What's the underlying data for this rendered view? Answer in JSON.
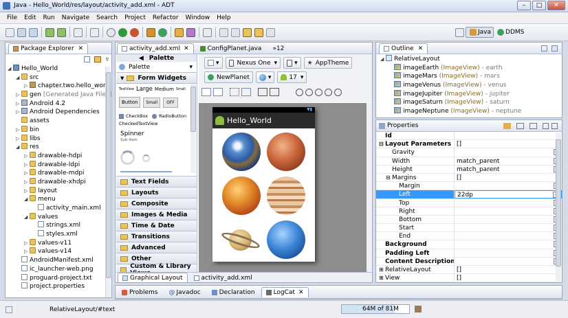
{
  "window": {
    "title": "Java - Hello_World/res/layout/activity_add.xml - ADT"
  },
  "menu": [
    "File",
    "Edit",
    "Run",
    "Navigate",
    "Search",
    "Project",
    "Refactor",
    "Window",
    "Help"
  ],
  "perspectives": {
    "java": "Java",
    "ddms": "DDMS"
  },
  "package_explorer": {
    "title": "Package Explorer",
    "items": [
      {
        "label": "Hello_World",
        "depth": 0,
        "exp": "◢",
        "icon": "proj"
      },
      {
        "label": "src",
        "depth": 1,
        "exp": "◢",
        "icon": "fold"
      },
      {
        "label": "chapter.two.hello_world",
        "depth": 2,
        "exp": "▷",
        "icon": "pkg"
      },
      {
        "label": "gen",
        "extra": " [Generated Java Files]",
        "depth": 1,
        "exp": "▷",
        "icon": "fold"
      },
      {
        "label": "Android 4.2",
        "depth": 1,
        "exp": "▷",
        "icon": "lib"
      },
      {
        "label": "Android Dependencies",
        "depth": 1,
        "exp": "▷",
        "icon": "lib"
      },
      {
        "label": "assets",
        "depth": 1,
        "exp": "",
        "icon": "fold"
      },
      {
        "label": "bin",
        "depth": 1,
        "exp": "▷",
        "icon": "fold"
      },
      {
        "label": "libs",
        "depth": 1,
        "exp": "▷",
        "icon": "fold"
      },
      {
        "label": "res",
        "depth": 1,
        "exp": "◢",
        "icon": "fold"
      },
      {
        "label": "drawable-hdpi",
        "depth": 2,
        "exp": "▷",
        "icon": "fold"
      },
      {
        "label": "drawable-ldpi",
        "depth": 2,
        "exp": "▷",
        "icon": "fold"
      },
      {
        "label": "drawable-mdpi",
        "depth": 2,
        "exp": "▷",
        "icon": "fold"
      },
      {
        "label": "drawable-xhdpi",
        "depth": 2,
        "exp": "▷",
        "icon": "fold"
      },
      {
        "label": "layout",
        "depth": 2,
        "exp": "▷",
        "icon": "fold"
      },
      {
        "label": "menu",
        "depth": 2,
        "exp": "◢",
        "icon": "fold"
      },
      {
        "label": "activity_main.xml",
        "depth": 3,
        "exp": "",
        "icon": "xml"
      },
      {
        "label": "values",
        "depth": 2,
        "exp": "◢",
        "icon": "fold"
      },
      {
        "label": "strings.xml",
        "depth": 3,
        "exp": "",
        "icon": "xml"
      },
      {
        "label": "styles.xml",
        "depth": 3,
        "exp": "",
        "icon": "xml"
      },
      {
        "label": "values-v11",
        "depth": 2,
        "exp": "▷",
        "icon": "fold"
      },
      {
        "label": "values-v14",
        "depth": 2,
        "exp": "▷",
        "icon": "fold"
      },
      {
        "label": "AndroidManifest.xml",
        "depth": 1,
        "exp": "",
        "icon": "xml"
      },
      {
        "label": "ic_launcher-web.png",
        "depth": 1,
        "exp": "",
        "icon": "file"
      },
      {
        "label": "proguard-project.txt",
        "depth": 1,
        "exp": "",
        "icon": "file"
      },
      {
        "label": "project.properties",
        "depth": 1,
        "exp": "",
        "icon": "file"
      }
    ]
  },
  "editor": {
    "tabs": [
      {
        "label": "activity_add.xml"
      },
      {
        "label": "ConfigPlanet.java"
      },
      {
        "label": "»12"
      }
    ],
    "palette_title": "Palette",
    "palette_dropdown": "Palette",
    "form_widgets": "Form Widgets",
    "tv_text": "TextView",
    "tv_large": "Large",
    "tv_medium": "Medium",
    "tv_small": "Small",
    "btn_button": "Button",
    "btn_small": "Small",
    "btn_off": "OFF",
    "checkbox": "CheckBox",
    "radio": "RadioButton",
    "checked_tv": "CheckedTextView",
    "spinner": "Spinner",
    "subitem": "Sub Item",
    "categories": [
      "Text Fields",
      "Layouts",
      "Composite",
      "Images & Media",
      "Time & Date",
      "Transitions",
      "Advanced",
      "Other",
      "Custom & Library Views"
    ],
    "device": "Nexus One",
    "theme": "AppTheme",
    "activity": "NewPlanet",
    "api": "17",
    "app_title": "Hello_World",
    "bottom_tabs": [
      "Graphical Layout",
      "activity_add.xml"
    ]
  },
  "outline": {
    "title": "Outline",
    "root": "RelativeLayout",
    "items": [
      {
        "name": "imageEarth",
        "type": " (ImageView)",
        "suffix": " - earth"
      },
      {
        "name": "imageMars",
        "type": " (ImageView)",
        "suffix": " - mars"
      },
      {
        "name": "imageVenus",
        "type": " (ImageView)",
        "suffix": " - venus"
      },
      {
        "name": "imageJupiter",
        "type": " (ImageView)",
        "suffix": " - jupiter"
      },
      {
        "name": "imageSaturn",
        "type": " (ImageView)",
        "suffix": " - saturn"
      },
      {
        "name": "imageNeptune",
        "type": " (ImageView)",
        "suffix": " - neptune"
      }
    ]
  },
  "properties": {
    "title": "Properties",
    "rows": [
      {
        "k": "Id",
        "v": "",
        "bold": true,
        "ind": 0,
        "exp": ""
      },
      {
        "k": "Layout Parameters",
        "v": "[]",
        "bold": true,
        "ind": 0,
        "exp": "⊟"
      },
      {
        "k": "Gravity",
        "v": "",
        "ind": 1,
        "exp": "",
        "dots": true
      },
      {
        "k": "Width",
        "v": "match_parent",
        "ind": 1,
        "exp": "",
        "dots": true
      },
      {
        "k": "Height",
        "v": "match_parent",
        "ind": 1,
        "exp": "",
        "dots": true
      },
      {
        "k": "Margins",
        "v": "[]",
        "ind": 1,
        "exp": "⊟"
      },
      {
        "k": "Margin",
        "v": "",
        "ind": 2,
        "exp": "",
        "dots": true
      },
      {
        "k": "Left",
        "v": "22dp",
        "ind": 2,
        "exp": "",
        "dots": true,
        "sel": true
      },
      {
        "k": "Top",
        "v": "",
        "ind": 2,
        "exp": "",
        "dots": true
      },
      {
        "k": "Right",
        "v": "",
        "ind": 2,
        "exp": "",
        "dots": true
      },
      {
        "k": "Bottom",
        "v": "",
        "ind": 2,
        "exp": "",
        "dots": true
      },
      {
        "k": "Start",
        "v": "",
        "ind": 2,
        "exp": "",
        "dots": true
      },
      {
        "k": "End",
        "v": "",
        "ind": 2,
        "exp": "",
        "dots": true
      },
      {
        "k": "Background",
        "v": "",
        "bold": true,
        "ind": 0,
        "exp": "",
        "dots": true
      },
      {
        "k": "Padding Left",
        "v": "",
        "bold": true,
        "ind": 0,
        "exp": "",
        "dots": true
      },
      {
        "k": "Content Description",
        "v": "",
        "bold": true,
        "ind": 0,
        "exp": "",
        "dots": true
      },
      {
        "k": "RelativeLayout",
        "v": "[]",
        "ind": 0,
        "exp": "⊞"
      },
      {
        "k": "View",
        "v": "[]",
        "ind": 0,
        "exp": "⊞"
      }
    ]
  },
  "bottom": {
    "tabs": [
      "Problems",
      "Javadoc",
      "Declaration",
      "LogCat"
    ]
  },
  "status": {
    "left": "RelativeLayout/#text",
    "heap": "64M of 81M"
  }
}
